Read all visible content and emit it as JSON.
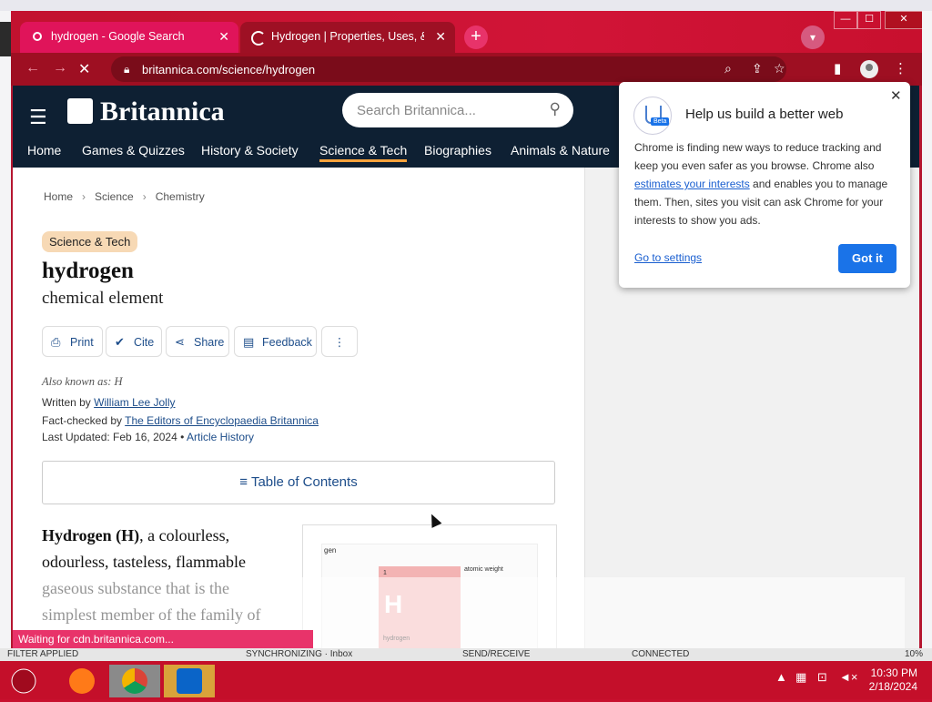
{
  "window": {
    "tabs": [
      {
        "title": "hydrogen - Google Search"
      },
      {
        "title": "Hydrogen | Properties, Uses, & Facts"
      }
    ],
    "new_tab_symbol": "+",
    "controls": {
      "minimize": "—",
      "maximize": "☐",
      "close": "✕"
    }
  },
  "toolbar": {
    "url": "britannica.com/science/hydrogen"
  },
  "site": {
    "brand": "Britannica",
    "search_placeholder": "Search Britannica...",
    "nav": [
      "Home",
      "Games & Quizzes",
      "History & Society",
      "Science & Tech",
      "Biographies",
      "Animals & Nature"
    ],
    "active_nav": "Science & Tech"
  },
  "article": {
    "breadcrumbs": [
      "Home",
      "Science",
      "Chemistry"
    ],
    "category_tag": "Science & Tech",
    "title": "hydrogen",
    "subtitle": "chemical element",
    "actions": [
      "Print",
      "Cite",
      "Share",
      "Feedback"
    ],
    "also_known_as": "Also known as: H",
    "written_by_label": "Written by",
    "author": "William Lee Jolly",
    "fact_checked_label": "Fact-checked by",
    "fact_checker": "The Editors of Encyclopaedia Britannica",
    "last_updated": "Last Updated: Feb 16, 2024 •",
    "article_history": "Article History",
    "toc_label": "Table of Contents",
    "lead_bold": "Hydrogen (H)",
    "lead_text": ", a colourless, odourless, tasteless, flammable gaseous substance that is the simplest member of the family of",
    "image_labels": {
      "heading": "gen",
      "symbol": "H",
      "number": "1",
      "name": "hydrogen",
      "weight": "atomic weight"
    }
  },
  "popup": {
    "badge": "Beta",
    "title": "Help us build a better web",
    "body_1": "Chrome is finding new ways to reduce tracking and keep you even safer as you browse. Chrome also ",
    "body_link": "estimates your interests",
    "body_2": " and enables you to manage them. Then, sites you visit can ask Chrome for your interests to show you ads.",
    "settings_link": "Go to settings",
    "confirm_button": "Got it"
  },
  "status_bar": "Waiting for cdn.britannica.com...",
  "outlook_bar": {
    "filter": "FILTER APPLIED",
    "sync": "SYNCHRONIZING · Inbox",
    "send": "SEND/RECEIVE",
    "connected": "CONNECTED",
    "zoom": "10%"
  },
  "taskbar": {
    "time": "10:30 PM",
    "date": "2/18/2024"
  },
  "colors": {
    "browser_theme": "#c8102e",
    "britannica_header": "#0e2033",
    "active_nav_underline": "#f6a23c",
    "link_blue": "#1d4d8a",
    "chrome_blue": "#1a73e8"
  },
  "icons": {
    "hamburger": "menu-icon",
    "search": "search-icon",
    "lock": "lock-icon",
    "print": "print-icon",
    "cite": "cite-icon",
    "share": "share-icon",
    "feedback": "feedback-icon",
    "more": "more-vert-icon"
  }
}
